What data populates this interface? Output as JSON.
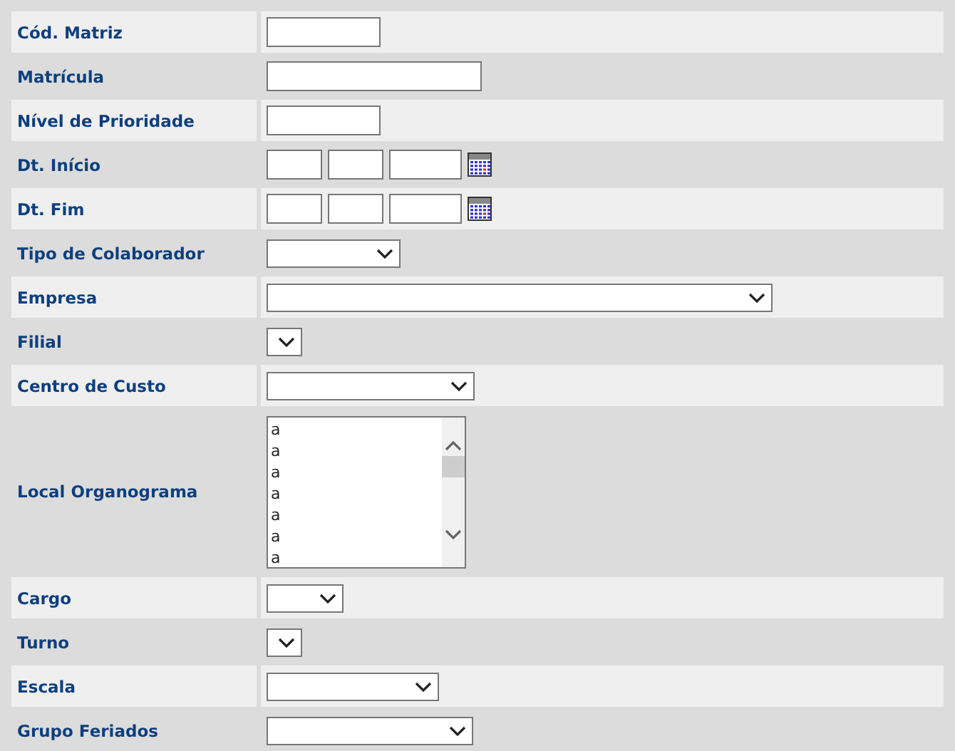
{
  "fields": [
    {
      "label": "Cód. Matriz",
      "kind": "text"
    },
    {
      "label": "Matrícula",
      "kind": "text"
    },
    {
      "label": "Nível de Prioridade",
      "kind": "text"
    },
    {
      "label": "Dt. Início",
      "kind": "date"
    },
    {
      "label": "Dt. Fim",
      "kind": "date"
    },
    {
      "label": "Tipo de Colaborador",
      "kind": "select"
    },
    {
      "label": "Empresa",
      "kind": "select"
    },
    {
      "label": "Filial",
      "kind": "select"
    },
    {
      "label": "Centro de Custo",
      "kind": "select"
    },
    {
      "label": "Local Organograma",
      "kind": "listbox",
      "items": [
        "a",
        "a",
        "a",
        "a",
        "a",
        "a",
        "a"
      ]
    },
    {
      "label": "Cargo",
      "kind": "select"
    },
    {
      "label": "Turno",
      "kind": "select"
    },
    {
      "label": "Escala",
      "kind": "select"
    },
    {
      "label": "Grupo Feriados",
      "kind": "select"
    }
  ]
}
